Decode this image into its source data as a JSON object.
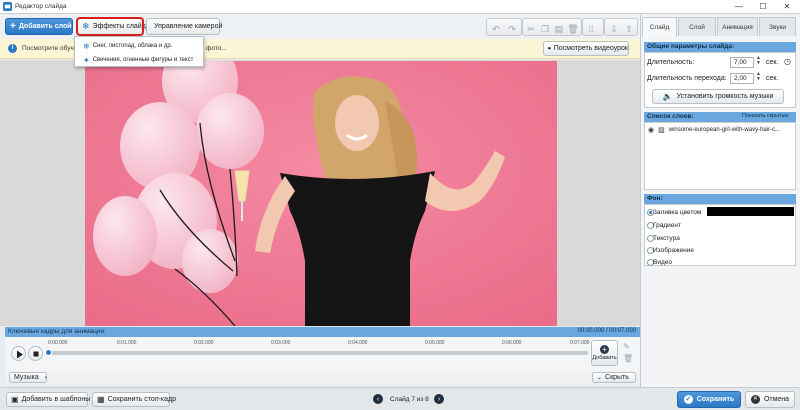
{
  "window": {
    "title": "Редактор слайда",
    "controls": [
      "—",
      "☐",
      "✕"
    ]
  },
  "toolbar": {
    "add_layer": "Добавить слой",
    "slide_effects": "Эффекты слайда",
    "camera_control": "Управление камерой"
  },
  "effects_menu": {
    "items": [
      "Снег, листопад, облака и др.",
      "Свечения, огненные фигуры и текст"
    ]
  },
  "notice": {
    "text": "Посмотрите обучаю",
    "text_tail": "фото...",
    "watch_button": "Посмотреть видеоурок"
  },
  "keyframes": {
    "title": "Ключевые кадры для анимации:",
    "time": "00:00.000 / 00:07.000",
    "ticks": [
      "0:00.000",
      "0:01.000",
      "0:02.000",
      "0:03.000",
      "0:04.000",
      "0:05.000",
      "0:06.000",
      "0:07.000"
    ],
    "add_label": "Добавить",
    "hide_label": "Скрыть",
    "music_label": "Музыка"
  },
  "bottom": {
    "add_to_templates": "Добавить в шаблоны",
    "save_frame": "Сохранить стоп-кадр",
    "slide_counter": "Слайд 7 из 8",
    "save": "Сохранить",
    "cancel": "Отмена"
  },
  "right_panel": {
    "tabs": [
      "Слайд",
      "Слой",
      "Анимация",
      "Звуки"
    ],
    "active_tab": "Слайд",
    "general": {
      "header": "Общие параметры слайда:",
      "duration_label": "Длительность:",
      "duration_value": "7,00",
      "duration_unit": "сек.",
      "transition_label": "Длительность перехода:",
      "transition_value": "2,00",
      "transition_unit": "сек.",
      "volume_button": "Установить громкость музыки"
    },
    "layers": {
      "header": "Список слоев:",
      "show_hidden": "Показать скрытые",
      "items": [
        "winsome-european-girl-with-wavy-hair-c..."
      ]
    },
    "background": {
      "header": "Фон:",
      "options": [
        "Заливка цветом",
        "Градиент",
        "Текстура",
        "Изображение",
        "Видео"
      ],
      "selected": "Заливка цветом",
      "fill_color": "#000000"
    }
  },
  "colors": {
    "accent": "#2a79c6",
    "section_header": "#6aa7df",
    "notice_bg": "#fdf6d6",
    "photo_bg": "#f07b95",
    "highlight": "#d81e1e"
  }
}
